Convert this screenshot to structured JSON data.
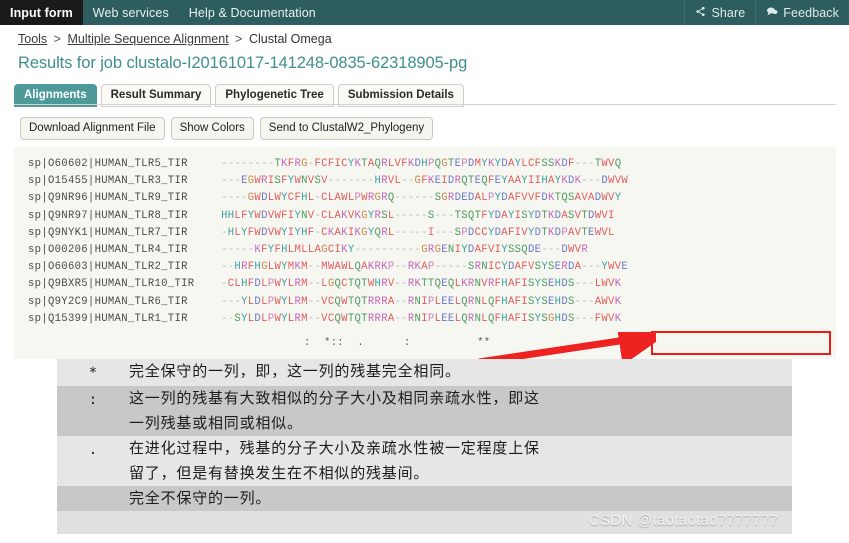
{
  "topbar": {
    "left_items": [
      {
        "label": "Input form",
        "active": true
      },
      {
        "label": "Web services",
        "active": false
      },
      {
        "label": "Help & Documentation",
        "active": false
      }
    ],
    "right_items": [
      {
        "label": "Share",
        "icon": "share-icon"
      },
      {
        "label": "Feedback",
        "icon": "speech-bubble-icon"
      }
    ],
    "bg_color": "#2d5d5e",
    "active_bg_color": "#1a1a1a"
  },
  "breadcrumb": {
    "items": [
      "Tools",
      "Multiple Sequence Alignment",
      "Clustal Omega"
    ],
    "separator": ">"
  },
  "page": {
    "title": "Results for job clustalo-I20161017-141248-0835-62318905-pg",
    "title_color": "#3f8f8e"
  },
  "tabs": [
    {
      "label": "Alignments",
      "active": true
    },
    {
      "label": "Result Summary",
      "active": false
    },
    {
      "label": "Phylogenetic Tree",
      "active": false
    },
    {
      "label": "Submission Details",
      "active": false
    }
  ],
  "actions": [
    {
      "label": "Download Alignment File"
    },
    {
      "label": "Show Colors"
    },
    {
      "label": "Send to ClustalW2_Phylogeny"
    }
  ],
  "alignment": {
    "rows": [
      {
        "id": "sp|O60602|HUMAN_TLR5_TIR",
        "sequence": "--------TKFRG-FCFICYKTAQRLVFKDHPQGTEPDMYKYDAYLCFSSKDF---TWVQ"
      },
      {
        "id": "sp|O15455|HUMAN_TLR3_TIR",
        "sequence": "---EGWRISFYWNVSV-------HRVL--GFKEIDRQTEQFEYAAYIIHAYKDK---DWVW"
      },
      {
        "id": "sp|Q9NR96|HUMAN_TLR9_TIR",
        "sequence": "----GWDLWYCFHL-CLAWLPWRGRQ------SGRDEDALPYDAFVVFDKTQSAVADWVY"
      },
      {
        "id": "sp|Q9NR97|HUMAN_TLR8_TIR",
        "sequence": "HHLFYWDVWFIYNV-CLAKVKGYRSL-----S---TSQTFYDAYISYDTKDASVTDWVI"
      },
      {
        "id": "sp|Q9NYK1|HUMAN_TLR7_TIR",
        "sequence": "-HLYFWDVWYIYHF-CKAKIKGYQRL-----I---SPDCCYDAFIVYDTKDPAVTEWVL"
      },
      {
        "id": "sp|O00206|HUMAN_TLR4_TIR",
        "sequence": "-----KFYFHLMLLAGCIKY----------GRGENIYDAFVIYSSQDE---DWVR"
      },
      {
        "id": "sp|O60603|HUMAN_TLR2_TIR",
        "sequence": "--HRFHGLWYMKM--MWAWLQAKRKP--RKAP-----SRNICYDAFVSYSERDA---YWVE"
      },
      {
        "id": "sp|Q9BXR5|HUMAN_TLR10_TIR",
        "sequence": "-CLHFDLPWYLRM--LGQCTQTWHRV--RKTTQEQLKRNVRFHAFISYSEHDS---LWVK"
      },
      {
        "id": "sp|Q9Y2C9|HUMAN_TLR6_TIR",
        "sequence": "---YLDLPWYLRM--VCQWTQTRRRA--RNIPLEELQRNLQFHAFISYSEHDS---AWVK"
      },
      {
        "id": "sp|Q15399|HUMAN_TLR1_TIR",
        "sequence": "--SYLDLPWYLRM--VCQWTQTRRRA--RNIPLEELQRNLQFHAFISYSGHDS---FWVK"
      }
    ],
    "conservation_line": ":  *::  .      :          **",
    "highlight_box_color": "#ef1b1b",
    "arrow_color": "#ef2222",
    "panel_bg": "#f7f7f2"
  },
  "explanation": {
    "rows": [
      {
        "symbol": "*",
        "lines": [
          "完全保守的一列，即，这一列的残基完全相同。"
        ],
        "shaded": false
      },
      {
        "symbol": ":",
        "lines": [
          "这一列的残基有大致相似的分子大小及相同亲疏水性，即这",
          "一列残基或相同或相似。"
        ],
        "shaded": true
      },
      {
        "symbol": ".",
        "lines": [
          "在进化过程中，残基的分子大小及亲疏水性被一定程度上保",
          "留了，但是有替换发生在不相似的残基间。"
        ],
        "shaded": false
      },
      {
        "symbol": "",
        "lines": [
          "完全不保守的一列。"
        ],
        "shaded": true
      }
    ]
  },
  "watermark": {
    "text": "CSDN @taotaotao7777777"
  }
}
